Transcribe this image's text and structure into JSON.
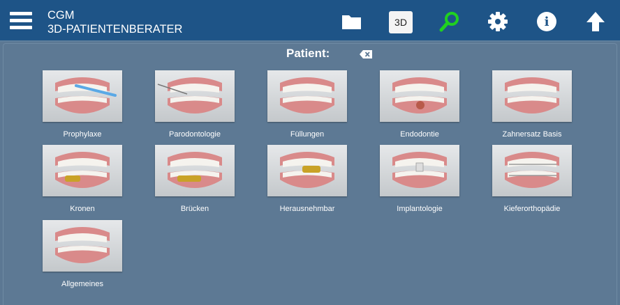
{
  "header": {
    "title_line1": "CGM",
    "title_line2": "3D-PATIENTENBERATER",
    "btn_3d_label": "3D",
    "search_icon_color": "#20d020",
    "background": "#1e5487"
  },
  "main": {
    "patient_label": "Patient:"
  },
  "tiles": [
    {
      "label": "Prophylaxe"
    },
    {
      "label": "Parodontologie"
    },
    {
      "label": "Füllungen"
    },
    {
      "label": "Endodontie"
    },
    {
      "label": "Zahnersatz Basis"
    },
    {
      "label": "Kronen"
    },
    {
      "label": "Brücken"
    },
    {
      "label": "Herausnehmbar"
    },
    {
      "label": "Implantologie"
    },
    {
      "label": "Kieferorthopädie"
    },
    {
      "label": "Allgemeines"
    }
  ]
}
